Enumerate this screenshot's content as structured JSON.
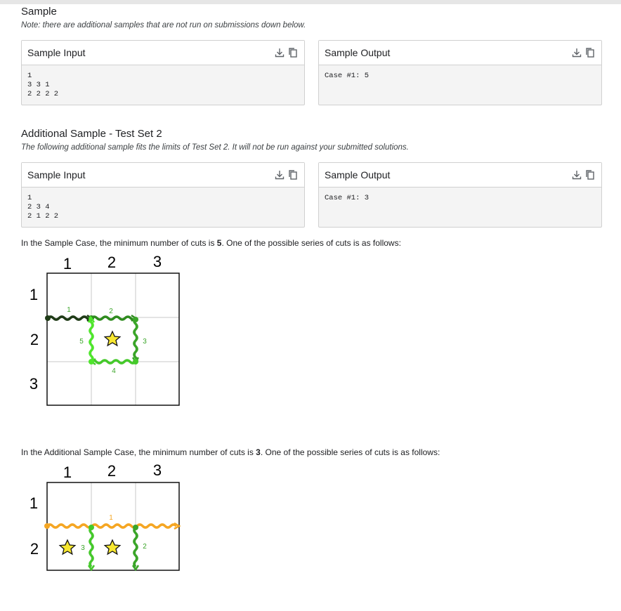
{
  "sample": {
    "title": "Sample",
    "note": "Note: there are additional samples that are not run on submissions down below.",
    "input": {
      "label": "Sample Input",
      "text": "1\n3 3 1\n2 2 2 2"
    },
    "output": {
      "label": "Sample Output",
      "text": "Case #1: 5"
    }
  },
  "additional": {
    "title": "Additional Sample - Test Set 2",
    "note": "The following additional sample fits the limits of Test Set 2. It will not be run against your submitted solutions.",
    "input": {
      "label": "Sample Input",
      "text": "1\n2 3 4\n2 1 2 2"
    },
    "output": {
      "label": "Sample Output",
      "text": "Case #1: 3"
    }
  },
  "explain1": {
    "before": "In the Sample Case, the minimum number of cuts is ",
    "value": "5",
    "after": ". One of the possible series of cuts is as follows:"
  },
  "explain2": {
    "before": "In the Additional Sample Case, the minimum number of cuts is ",
    "value": "3",
    "after": ". One of the possible series of cuts is as follows:"
  },
  "figure1": {
    "col_labels": [
      "1",
      "2",
      "3"
    ],
    "row_labels": [
      "1",
      "2",
      "3"
    ],
    "cut_labels": [
      "1",
      "2",
      "3",
      "4",
      "5"
    ]
  },
  "figure2": {
    "col_labels": [
      "1",
      "2",
      "3"
    ],
    "row_labels": [
      "1",
      "2"
    ],
    "cut_labels": [
      "1",
      "2",
      "3"
    ]
  },
  "icons": {
    "download": "download-icon",
    "copy": "copy-icon"
  },
  "colors": {
    "dark_green": "#1b5e20",
    "green": "#2e9e1f",
    "light_green": "#46d62a",
    "orange": "#f5a623",
    "star": "#f7e731"
  }
}
